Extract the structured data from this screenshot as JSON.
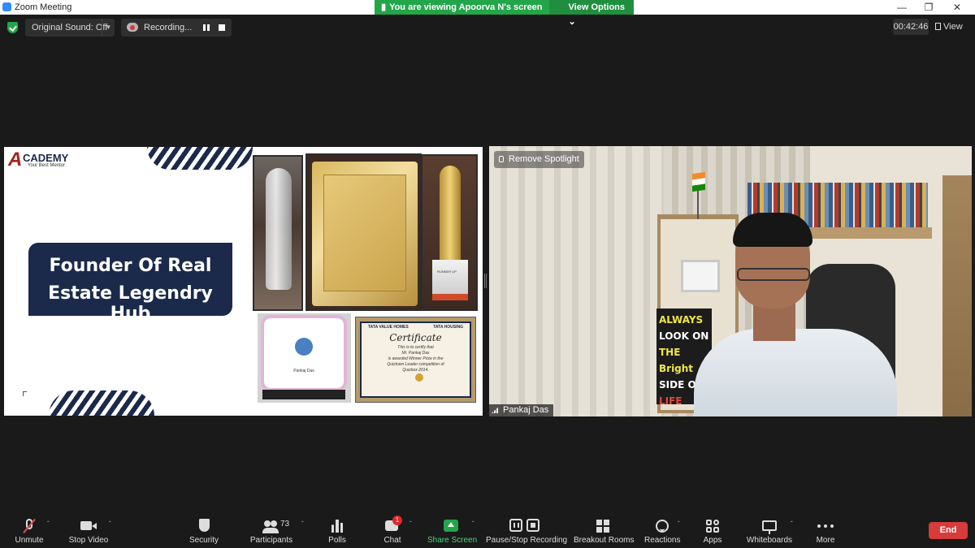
{
  "window": {
    "title": "Zoom Meeting",
    "icon": "zoom-app-icon",
    "controls": [
      "minimize",
      "restore",
      "close"
    ]
  },
  "banner": {
    "viewing_text": "You are viewing Apoorva N's screen",
    "view_options_label": "View Options",
    "color": "#23a54a"
  },
  "top_bar": {
    "original_sound_label": "Original Sound: Off",
    "recording_label": "Recording...",
    "timer": "00:42:46",
    "view_label": "View"
  },
  "slide": {
    "logo_mark": "A",
    "logo_name": "CADEMY",
    "logo_tagline": "Your Best Mentor",
    "headline_line1": "Founder Of Real",
    "headline_line2": "Estate Legendry Hub",
    "award_plaque_name": "Pankaj Das",
    "certificate_brand_left": "TATA VALUE HOMES",
    "certificate_brand_right": "TATA HOUSING",
    "certificate_title": "Certificate",
    "certificate_line1": "This is to certify that",
    "certificate_line2": "Mr. Pankaj Das",
    "certificate_line3": "is awarded Winner Prize in the",
    "certificate_line4": "Quiztown Leader competition of",
    "certificate_line5": "Quizbox 2014.",
    "trophy_text": "RUNNER UP",
    "accent_color": "#1b2a4a"
  },
  "video": {
    "remove_spotlight_label": "Remove Spotlight",
    "participant_name": "Pankaj Das",
    "poster_lines": [
      "ALWAYS",
      "LOOK ON",
      "THE Bright",
      "SIDE OF",
      "LIFE"
    ]
  },
  "toolbar": {
    "unmute": "Unmute",
    "stop_video": "Stop Video",
    "security": "Security",
    "participants": "Participants",
    "participants_count": "73",
    "polls": "Polls",
    "chat": "Chat",
    "chat_badge": "1",
    "share_screen": "Share Screen",
    "pause_stop_recording": "Pause/Stop Recording",
    "breakout_rooms": "Breakout Rooms",
    "reactions": "Reactions",
    "apps": "Apps",
    "whiteboards": "Whiteboards",
    "more": "More",
    "end": "End",
    "end_color": "#d83b3b",
    "share_color": "#23a54a"
  }
}
